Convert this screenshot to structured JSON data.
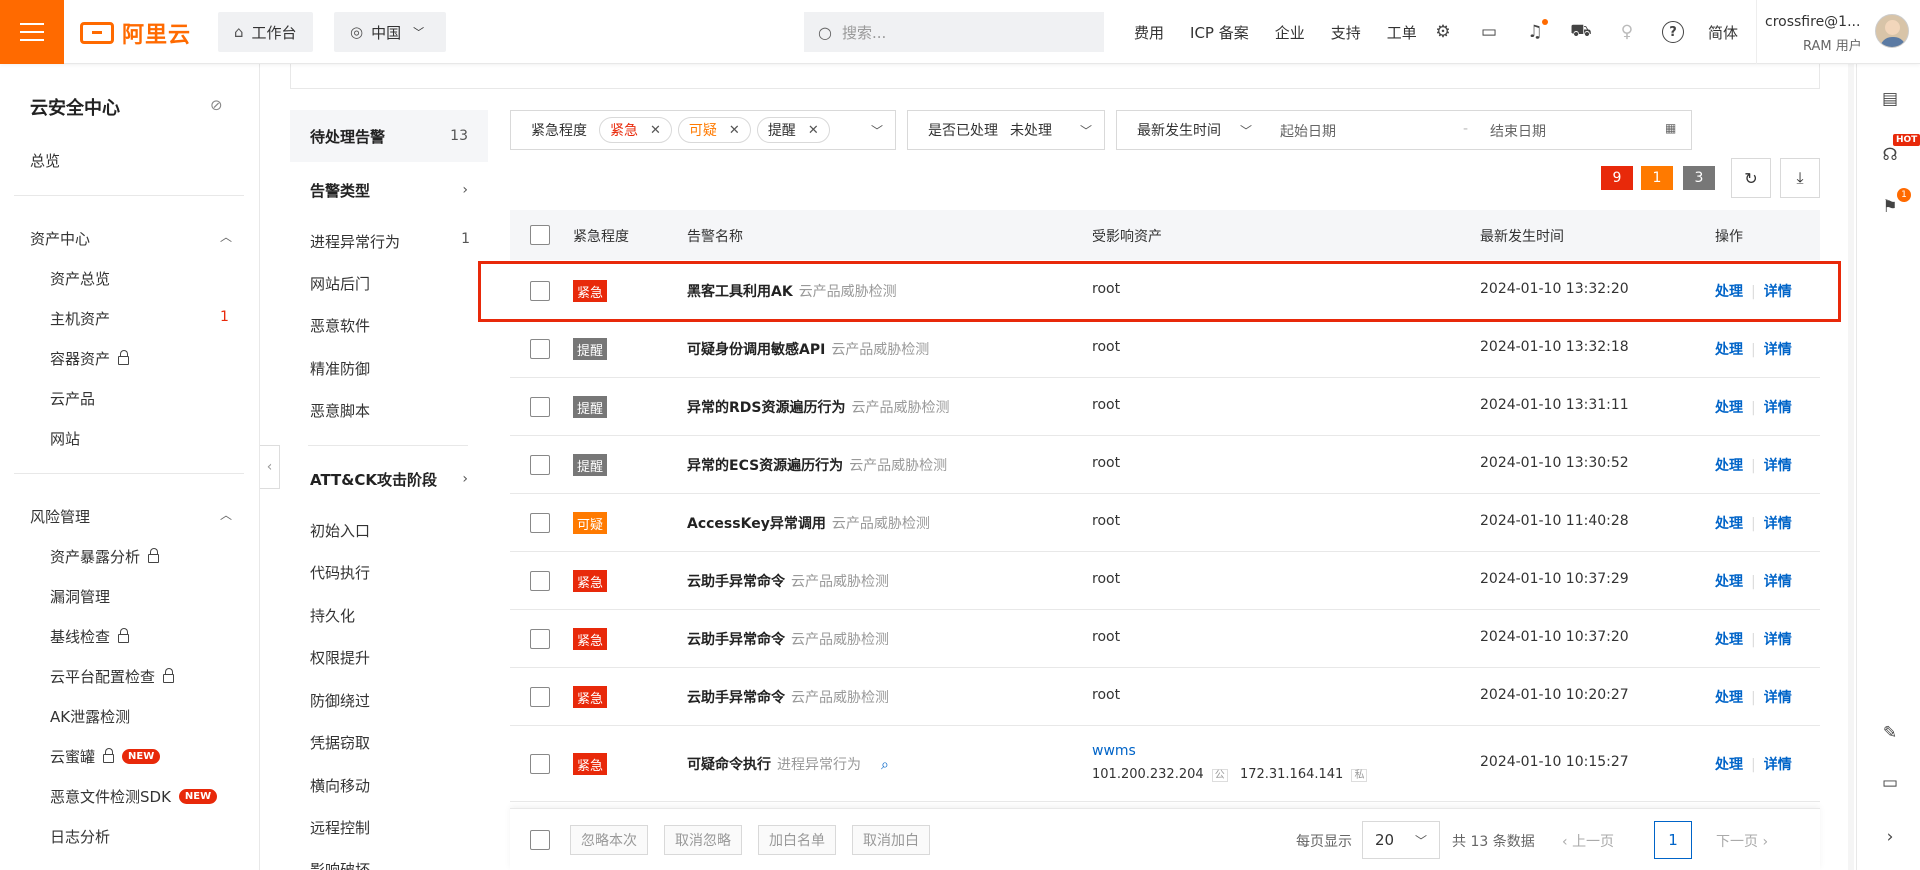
{
  "header": {
    "logo_text": "阿里云",
    "workbench": "工作台",
    "region": "中国",
    "search_placeholder": "搜索...",
    "links": [
      "费用",
      "ICP 备案",
      "企业",
      "支持",
      "工单"
    ],
    "lang": "简体",
    "user_name": "crossfire@1...",
    "user_role": "RAM 用户"
  },
  "sidebar": {
    "title": "云安全中心",
    "overview": "总览",
    "asset_center": "资产中心",
    "asset_items": [
      "资产总览",
      "主机资产",
      "容器资产",
      "云产品",
      "网站"
    ],
    "host_asset_count": "1",
    "risk_mgmt": "风险管理",
    "risk_items": [
      "资产暴露分析",
      "漏洞管理",
      "基线检查",
      "云平台配置检查",
      "AK泄露检测",
      "云蜜罐",
      "恶意文件检测SDK",
      "日志分析"
    ],
    "new_badge": "NEW"
  },
  "filter_col": {
    "pending_label": "待处理告警",
    "pending_count": "13",
    "alert_type": "告警类型",
    "types": [
      {
        "label": "进程异常行为",
        "count": "1"
      },
      {
        "label": "网站后门",
        "count": ""
      },
      {
        "label": "恶意软件",
        "count": ""
      },
      {
        "label": "精准防御",
        "count": ""
      },
      {
        "label": "恶意脚本",
        "count": ""
      }
    ],
    "attck": "ATT&CK攻击阶段",
    "stages": [
      "初始入口",
      "代码执行",
      "持久化",
      "权限提升",
      "防御绕过",
      "凭据窃取",
      "横向移动",
      "远程控制",
      "影响破坏"
    ]
  },
  "filters": {
    "severity_label": "紧急程度",
    "severity_tags": [
      "紧急",
      "可疑",
      "提醒"
    ],
    "handled_label": "是否已处理",
    "handled_value": "未处理",
    "time_label": "最新发生时间",
    "start_date": "起始日期",
    "dash": "-",
    "end_date": "结束日期"
  },
  "counts": {
    "urgent": "9",
    "suspicious": "1",
    "reminder": "3"
  },
  "table": {
    "headers": {
      "severity": "紧急程度",
      "name": "告警名称",
      "asset": "受影响资产",
      "time": "最新发生时间",
      "ops": "操作"
    },
    "op_handle": "处理",
    "op_detail": "详情",
    "rows": [
      {
        "sev": "紧急",
        "sev_color": "#e8290a",
        "name": "黑客工具利用AK",
        "src": "云产品威胁检测",
        "asset": "root",
        "time": "2024-01-10 13:32:20"
      },
      {
        "sev": "提醒",
        "sev_color": "#777777",
        "name": "可疑身份调用敏感API",
        "src": "云产品威胁检测",
        "asset": "root",
        "time": "2024-01-10 13:32:18"
      },
      {
        "sev": "提醒",
        "sev_color": "#777777",
        "name": "异常的RDS资源遍历行为",
        "src": "云产品威胁检测",
        "asset": "root",
        "time": "2024-01-10 13:31:11"
      },
      {
        "sev": "提醒",
        "sev_color": "#777777",
        "name": "异常的ECS资源遍历行为",
        "src": "云产品威胁检测",
        "asset": "root",
        "time": "2024-01-10 13:30:52"
      },
      {
        "sev": "可疑",
        "sev_color": "#ff7a00",
        "name": "AccessKey异常调用",
        "src": "云产品威胁检测",
        "asset": "root",
        "time": "2024-01-10 11:40:28"
      },
      {
        "sev": "紧急",
        "sev_color": "#e8290a",
        "name": "云助手异常命令",
        "src": "云产品威胁检测",
        "asset": "root",
        "time": "2024-01-10 10:37:29"
      },
      {
        "sev": "紧急",
        "sev_color": "#e8290a",
        "name": "云助手异常命令",
        "src": "云产品威胁检测",
        "asset": "root",
        "time": "2024-01-10 10:37:20"
      },
      {
        "sev": "紧急",
        "sev_color": "#e8290a",
        "name": "云助手异常命令",
        "src": "云产品威胁检测",
        "asset": "root",
        "time": "2024-01-10 10:20:27"
      }
    ],
    "last_row": {
      "sev": "紧急",
      "name": "可疑命令执行",
      "src": "进程异常行为",
      "asset_name": "wwms",
      "public_ip": "101.200.232.204",
      "public_tag": "公",
      "private_ip": "172.31.164.141",
      "private_tag": "私",
      "time": "2024-01-10 10:15:27"
    }
  },
  "footer": {
    "buttons": [
      "忽略本次",
      "取消忽略",
      "加白名单",
      "取消加白"
    ],
    "per_page_label": "每页显示",
    "per_page": "20",
    "total": "共 13 条数据",
    "prev": "上一页",
    "page": "1",
    "next": "下一页"
  },
  "rail": {
    "hot": "HOT",
    "flag_count": "1"
  }
}
